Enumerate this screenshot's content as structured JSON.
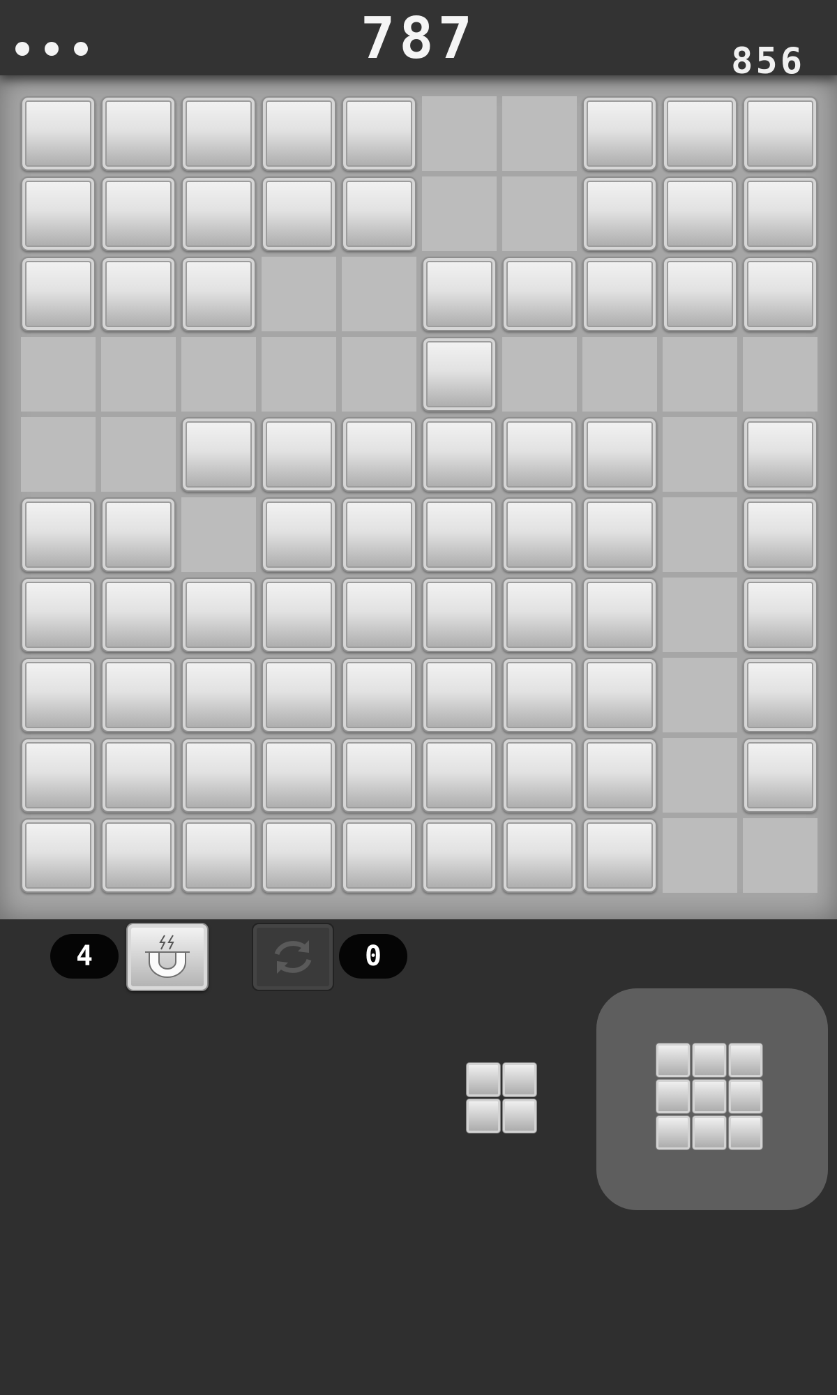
{
  "header": {
    "score": "787",
    "best_score": "856",
    "menu_icon": "more-dots-icon"
  },
  "board": {
    "rows": 10,
    "cols": 10,
    "cells": [
      "1111100111",
      "1111100111",
      "1110011111",
      "0000010000",
      "0011111101",
      "1101111101",
      "1111111101",
      "1111111101",
      "1111111101",
      "1111111100"
    ]
  },
  "powerups": {
    "magnet": {
      "count": "4",
      "icon": "magnet-icon"
    },
    "swap": {
      "count": "0",
      "icon": "refresh-icon"
    }
  },
  "pieces": [
    {
      "rows": 2,
      "cols": 2,
      "selected": false
    },
    {
      "rows": 3,
      "cols": 3,
      "selected": true
    }
  ]
}
